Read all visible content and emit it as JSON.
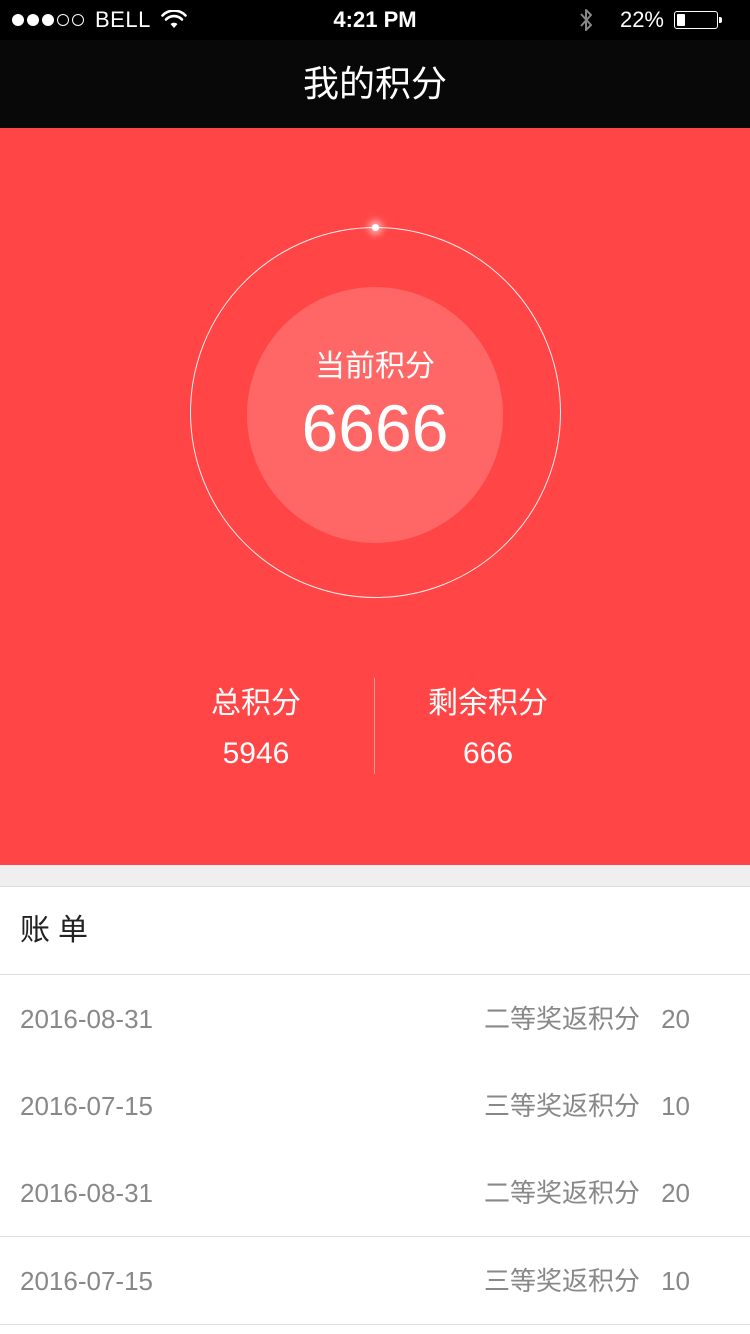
{
  "status_bar": {
    "signal_dots": [
      "full",
      "full",
      "full",
      "empty",
      "empty"
    ],
    "carrier": "BELL",
    "time": "4:21 PM",
    "battery_percent": "22%",
    "battery_level": 0.22,
    "icons": [
      "wifi-icon",
      "bluetooth-icon",
      "battery-icon"
    ]
  },
  "nav": {
    "title": "我的积分"
  },
  "points": {
    "current_label": "当前积分",
    "current_value": "6666",
    "total_label": "总积分",
    "total_value": "5946",
    "remaining_label": "剩余积分",
    "remaining_value": "666"
  },
  "bill": {
    "title": "账单",
    "rows": [
      {
        "date": "2016-08-31",
        "desc": "二等奖返积分",
        "points": "20"
      },
      {
        "date": "2016-07-15",
        "desc": "三等奖返积分",
        "points": "10"
      },
      {
        "date": "2016-08-31",
        "desc": "二等奖返积分",
        "points": "20"
      },
      {
        "date": "2016-07-15",
        "desc": "三等奖返积分",
        "points": "10"
      }
    ]
  },
  "colors": {
    "accent": "#ff4545",
    "accent_light": "#ff6767",
    "nav_bg": "#080808",
    "text_muted": "#888888"
  }
}
